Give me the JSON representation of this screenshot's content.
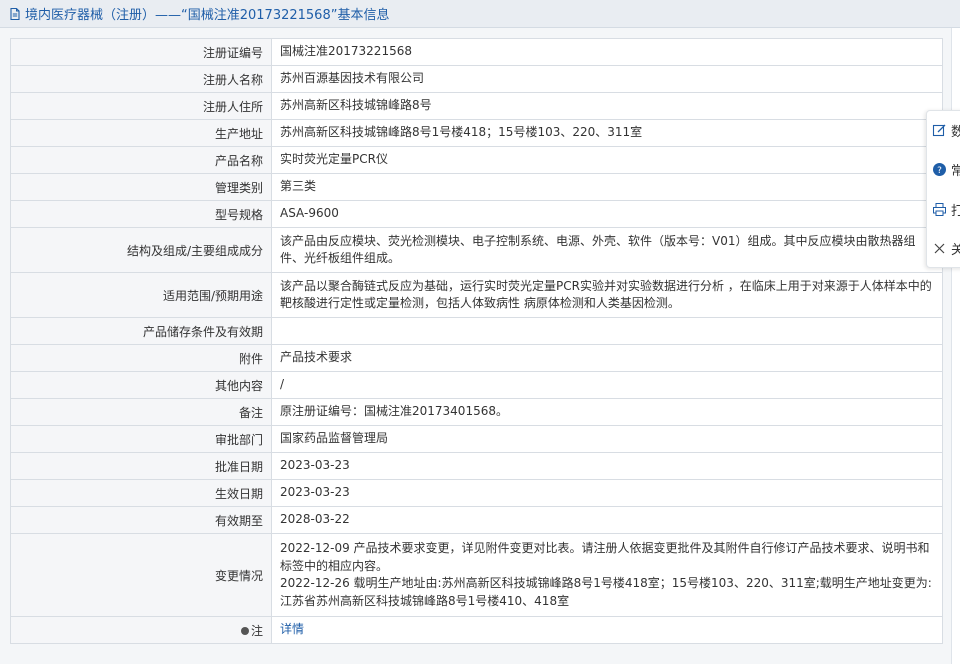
{
  "header": {
    "title": "境内医疗器械（注册）——“国械注准20173221568”基本信息"
  },
  "rows": [
    {
      "label": "注册证编号",
      "value": "国械注准20173221568"
    },
    {
      "label": "注册人名称",
      "value": "苏州百源基因技术有限公司"
    },
    {
      "label": "注册人住所",
      "value": "苏州高新区科技城锦峰路8号"
    },
    {
      "label": "生产地址",
      "value": "苏州高新区科技城锦峰路8号1号楼418；15号楼103、220、311室"
    },
    {
      "label": "产品名称",
      "value": "实时荧光定量PCR仪"
    },
    {
      "label": "管理类别",
      "value": "第三类"
    },
    {
      "label": "型号规格",
      "value": "ASA-9600"
    },
    {
      "label": "结构及组成/主要组成成分",
      "value": "该产品由反应模块、荧光检测模块、电子控制系统、电源、外壳、软件（版本号：V01）组成。其中反应模块由散热器组件、光纤板组件组成。"
    },
    {
      "label": "适用范围/预期用途",
      "value": "该产品以聚合酶链式反应为基础，运行实时荧光定量PCR实验并对实验数据进行分析 ，在临床上用于对来源于人体样本中的靶核酸进行定性或定量检测，包括人体致病性 病原体检测和人类基因检测。"
    },
    {
      "label": "产品储存条件及有效期",
      "value": ""
    },
    {
      "label": "附件",
      "value": "产品技术要求"
    },
    {
      "label": "其他内容",
      "value": "/"
    },
    {
      "label": "备注",
      "value": "原注册证编号：国械注准20173401568。"
    },
    {
      "label": "审批部门",
      "value": "国家药品监督管理局"
    },
    {
      "label": "批准日期",
      "value": "2023-03-23"
    },
    {
      "label": "生效日期",
      "value": "2023-03-23"
    },
    {
      "label": "有效期至",
      "value": "2028-03-22"
    },
    {
      "label": "变更情况",
      "value": ""
    },
    {
      "label": "注",
      "value": "详情"
    }
  ],
  "changes": [
    "2022-12-09 产品技术要求变更，详见附件变更对比表。请注册人依据变更批件及其附件自行修订产品技术要求、说明书和标签中的相应内容。",
    "2022-12-26 载明生产地址由:苏州高新区科技城锦峰路8号1号楼418室；15号楼103、220、311室;载明生产地址变更为:江苏省苏州高新区科技城锦峰路8号1号楼410、418室"
  ],
  "float_menu": [
    {
      "label": "数据纠错",
      "icon": "edit-icon"
    },
    {
      "label": "常见问题",
      "icon": "help-icon"
    },
    {
      "label": "打印",
      "icon": "print-icon"
    },
    {
      "label": "关闭",
      "icon": "close-icon"
    }
  ]
}
